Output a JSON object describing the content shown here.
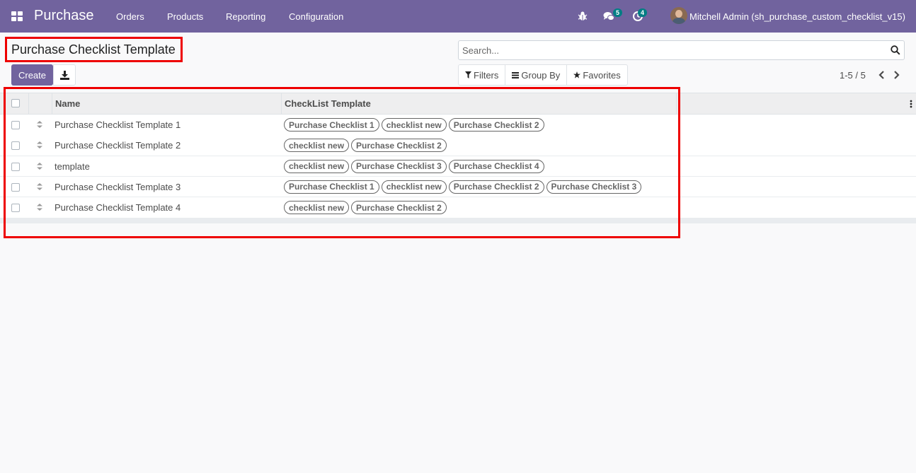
{
  "navbar": {
    "app_name": "Purchase",
    "menu": [
      "Orders",
      "Products",
      "Reporting",
      "Configuration"
    ],
    "messages_count": "5",
    "activities_count": "4",
    "user_name": "Mitchell Admin (sh_purchase_custom_checklist_v15)",
    "icons": [
      "apps-grid-icon",
      "bug-icon",
      "chat-bubbles-icon",
      "clock-activity-icon"
    ]
  },
  "control_panel": {
    "title": "Purchase Checklist Template",
    "create_label": "Create",
    "search_placeholder": "Search...",
    "filters_label": "Filters",
    "groupby_label": "Group By",
    "favorites_label": "Favorites",
    "pager": "1-5 / 5"
  },
  "table": {
    "columns": [
      "Name",
      "CheckList Template"
    ],
    "rows": [
      {
        "name": "Purchase Checklist Template 1",
        "tags": [
          "Purchase Checklist 1",
          "checklist new",
          "Purchase Checklist 2"
        ]
      },
      {
        "name": "Purchase Checklist Template 2",
        "tags": [
          "checklist new",
          "Purchase Checklist 2"
        ]
      },
      {
        "name": "template",
        "tags": [
          "checklist new",
          "Purchase Checklist 3",
          "Purchase Checklist 4"
        ]
      },
      {
        "name": "Purchase Checklist Template 3",
        "tags": [
          "Purchase Checklist 1",
          "checklist new",
          "Purchase Checklist 2",
          "Purchase Checklist 3"
        ]
      },
      {
        "name": "Purchase Checklist Template 4",
        "tags": [
          "checklist new",
          "Purchase Checklist 2"
        ]
      }
    ]
  },
  "colors": {
    "navbar": "#71639e",
    "highlight_box": "#ee0000",
    "badge": "#017e84"
  }
}
